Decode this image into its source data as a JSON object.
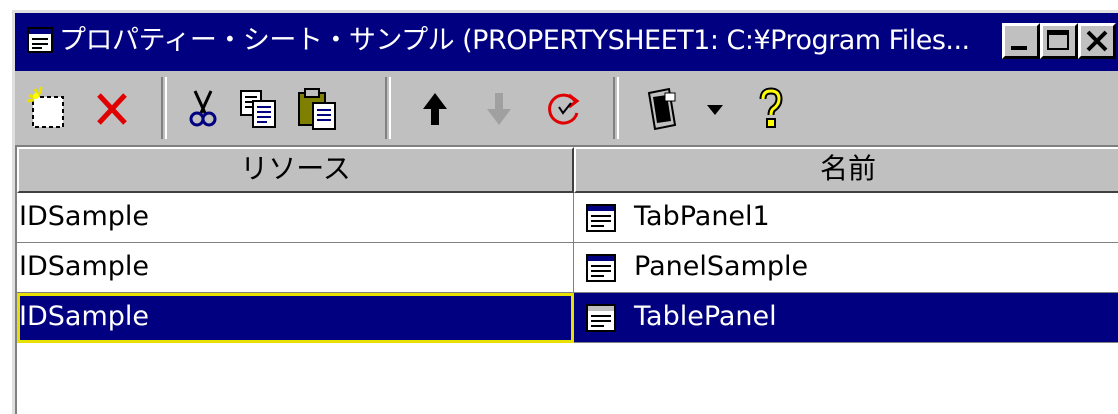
{
  "window": {
    "title": "プロパティー・シート・サンプル (PROPERTYSHEET1: C:¥Program Files...",
    "colors": {
      "titlebar": "#000080",
      "face": "#c0c0c0",
      "selection": "#000080",
      "focus_outline": "#e8e000"
    }
  },
  "title_buttons": {
    "minimize_icon": "minimize-icon",
    "maximize_icon": "maximize-icon",
    "close_icon": "close-icon"
  },
  "toolbar": {
    "items": [
      {
        "icon": "new-icon"
      },
      {
        "icon": "delete-icon"
      },
      {
        "icon": "cut-icon"
      },
      {
        "icon": "copy-icon"
      },
      {
        "icon": "paste-icon"
      },
      {
        "icon": "move-up-icon"
      },
      {
        "icon": "move-down-icon"
      },
      {
        "icon": "refresh-icon"
      },
      {
        "icon": "properties-icon"
      },
      {
        "icon": "dropdown-arrow-icon"
      },
      {
        "icon": "help-icon"
      }
    ]
  },
  "table": {
    "columns": [
      "リソース",
      "名前"
    ],
    "rows": [
      {
        "resource": "IDSample",
        "name": "TabPanel1",
        "icon": "panel-icon",
        "selected": false
      },
      {
        "resource": "IDSample",
        "name": "PanelSample",
        "icon": "panel-icon",
        "selected": false
      },
      {
        "resource": "IDSample",
        "name": "TablePanel",
        "icon": "panel-icon",
        "selected": true
      }
    ]
  }
}
